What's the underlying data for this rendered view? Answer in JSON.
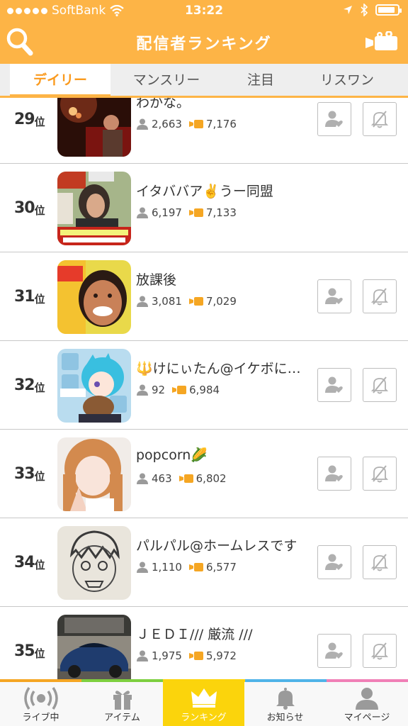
{
  "status_bar": {
    "carrier": "SoftBank",
    "time": "13:22",
    "battery_level": 0.9
  },
  "header": {
    "title": "配信者ランキング",
    "search_icon": "search-icon",
    "camera_icon": "video-camera-icon"
  },
  "tabs": [
    {
      "label": "デイリー",
      "active": true
    },
    {
      "label": "マンスリー",
      "active": false
    },
    {
      "label": "注目",
      "active": false
    },
    {
      "label": "リスワン",
      "active": false
    }
  ],
  "rankings": [
    {
      "rank": "29",
      "suffix": "位",
      "name": "わかな。",
      "listeners": "2,663",
      "points": "7,176"
    },
    {
      "rank": "30",
      "suffix": "位",
      "name": "イタババア✌️うー同盟",
      "listeners": "6,197",
      "points": "7,133"
    },
    {
      "rank": "31",
      "suffix": "位",
      "name": "放課後",
      "listeners": "3,081",
      "points": "7,029"
    },
    {
      "rank": "32",
      "suffix": "位",
      "name": "🔱けにぃたん@イケボに…",
      "listeners": "92",
      "points": "6,984"
    },
    {
      "rank": "33",
      "suffix": "位",
      "name": "popcorn🌽",
      "listeners": "463",
      "points": "6,802"
    },
    {
      "rank": "34",
      "suffix": "位",
      "name": "パルパル@ホームレスです",
      "listeners": "1,110",
      "points": "6,577"
    },
    {
      "rank": "35",
      "suffix": "位",
      "name": "ＪＥＤＩ/// 厳流 ///",
      "listeners": "1,975",
      "points": "5,972"
    }
  ],
  "bottom_nav": [
    {
      "label": "ライブ中",
      "icon": "live-broadcast-icon",
      "active": false
    },
    {
      "label": "アイテム",
      "icon": "gift-icon",
      "active": false
    },
    {
      "label": "ランキング",
      "icon": "crown-icon",
      "active": true
    },
    {
      "label": "お知らせ",
      "icon": "bell-icon",
      "active": false
    },
    {
      "label": "マイページ",
      "icon": "user-icon",
      "active": false
    }
  ],
  "colors": {
    "accent": "#fdb446",
    "active_tab_text": "#fa9a1e",
    "ranking_active": "#fbd40c",
    "stripe": [
      "#f5a623",
      "#7dcf3f",
      "#fbd40c",
      "#4fb3e8",
      "#f07fb6"
    ]
  }
}
